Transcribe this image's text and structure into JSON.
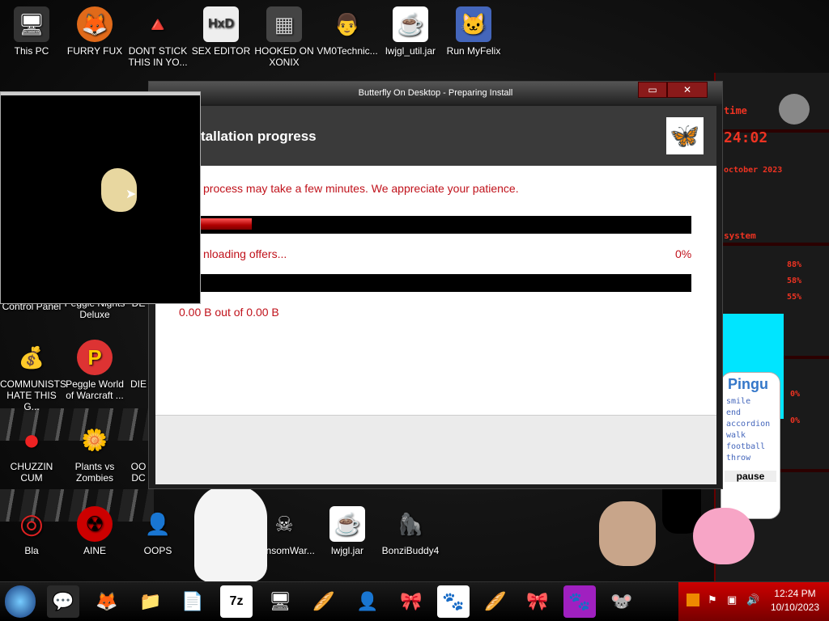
{
  "desktop": {
    "icons": [
      {
        "label": "This PC",
        "glyph": "🖥"
      },
      {
        "label": "FURRY FUX",
        "glyph": "🦊"
      },
      {
        "label": "DONT STICK THIS IN YO...",
        "glyph": "🔺"
      },
      {
        "label": "SEX EDITOR",
        "glyph": "HxD"
      },
      {
        "label": "HOOKED ON XONIX",
        "glyph": "▦"
      },
      {
        "label": "VM0Technic...",
        "glyph": "👨"
      },
      {
        "label": "lwjgl_util.jar",
        "glyph": "☕"
      },
      {
        "label": "Run MyFelix",
        "glyph": "🐱"
      },
      {
        "label": "Control Panel",
        "glyph": ""
      },
      {
        "label": "Peggle Nights Deluxe",
        "glyph": ""
      },
      {
        "label": "DE",
        "glyph": ""
      },
      {
        "label": "COMMUNISTS HATE THIS G...",
        "glyph": "💰"
      },
      {
        "label": "Peggle World of Warcraft ...",
        "glyph": "P"
      },
      {
        "label": "DIE",
        "glyph": ""
      },
      {
        "label": "CHUZZIN CUM",
        "glyph": "●"
      },
      {
        "label": "Plants vs Zombies",
        "glyph": "🌼"
      },
      {
        "label": "OO DC",
        "glyph": ""
      },
      {
        "label": "Bla",
        "glyph": "◎"
      },
      {
        "label": "AINE",
        "glyph": "☢"
      },
      {
        "label": "OOPS",
        "glyph": "👤"
      },
      {
        "label": "RansomWar...",
        "glyph": "☠"
      },
      {
        "label": "lwjgl.jar",
        "glyph": "☕"
      },
      {
        "label": "BonziBuddy4",
        "glyph": "🦍"
      }
    ]
  },
  "hud": {
    "clock": "24:02",
    "date": "october 2023",
    "system": "system",
    "pct1": "88%",
    "pct2": "58%",
    "pct3": "55%",
    "pct4": "0%",
    "pct5": "0%"
  },
  "pingu": {
    "title": "Pingu",
    "menu": [
      "smile",
      "end",
      "accordion",
      "walk",
      "football",
      "throw"
    ],
    "pause": "pause"
  },
  "installer": {
    "window_title": "Butterfly On Desktop - Preparing Install",
    "minimize": "▭",
    "close": "✕",
    "header_title": "tallation progress",
    "logo_glyph": "🦋",
    "notice": "process may take a few minutes. We appreciate your patience.",
    "status": "nloading offers...",
    "percent": "0%",
    "bytes": "0.00 B out of 0.00 B",
    "progress_main": 0.18,
    "progress_sub": 0.0
  },
  "taskbar": {
    "apps": [
      "🌐",
      "💬",
      "🦊",
      "📁",
      "📄",
      "7z",
      "🖥",
      "🥖",
      "👤",
      "🎀",
      "🐾",
      "🥖",
      "🎀",
      "🐾",
      "🐭"
    ],
    "time": "12:24 PM",
    "date": "10/10/2023"
  },
  "colors": {
    "accent": "#c0121b",
    "tray": "#c00000"
  }
}
